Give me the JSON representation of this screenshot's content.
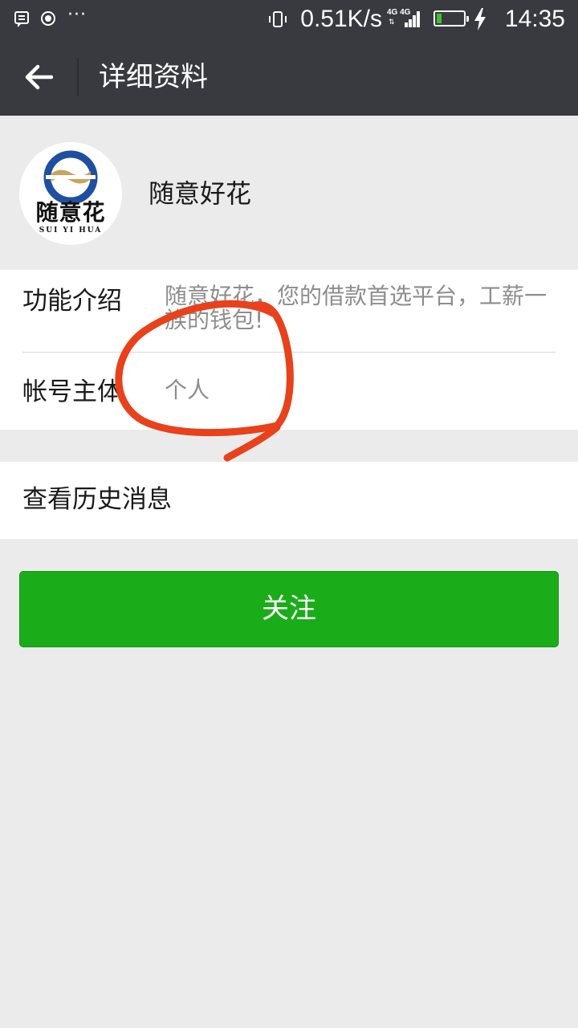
{
  "status_bar": {
    "speed": "0.51K/s",
    "network": "4G 4G",
    "battery_level": 0.2,
    "time": "14:35",
    "icons": [
      "message-icon",
      "record-icon",
      "more-icon",
      "vibrate-icon",
      "signal-icon",
      "battery-icon",
      "charging-bolt-icon"
    ]
  },
  "navbar": {
    "back_icon": "arrow-left-icon",
    "title": "详细资料"
  },
  "profile": {
    "avatar_text": "随意花",
    "avatar_sub": "SUI YI HUA",
    "name": "随意好花"
  },
  "info": {
    "intro_label": "功能介绍",
    "intro_value": "随意好花，您的借款首选平台，工薪一族的钱包!",
    "entity_label": "帐号主体",
    "entity_value": "个人"
  },
  "history": {
    "label": "查看历史消息"
  },
  "follow_button": {
    "label": "关注"
  },
  "colors": {
    "toolbar": "#393a3f",
    "background": "#ebebeb",
    "accent_green": "#1aad19",
    "annotation_red": "#e8411b"
  }
}
